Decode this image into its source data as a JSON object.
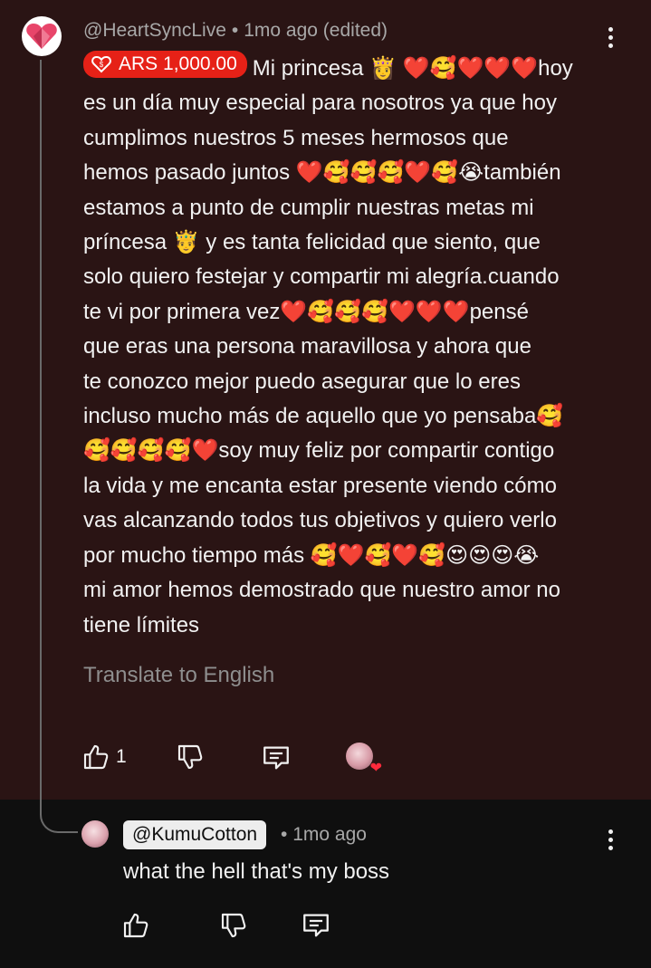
{
  "comment": {
    "author": "@HeartSyncLive",
    "separator": "•",
    "time": "1mo ago (edited)",
    "donation": "ARS 1,000.00",
    "lines": [
      "Mi princesa 👸 ❤️🥰❤️❤️❤️hoy",
      "es un día muy especial para nosotros ya que hoy",
      "cumplimos nuestros 5 meses hermosos que",
      "hemos pasado juntos ❤️🥰🥰🥰❤️🥰😭también",
      "estamos a punto de cumplir nuestras metas mi",
      "príncesa 🤴 y es tanta felicidad que siento, que",
      "solo quiero festejar y compartir mi alegría.cuando",
      "te vi por primera vez❤️🥰🥰🥰❤️❤️❤️pensé",
      "que eras una persona maravillosa y ahora que",
      "te conozco mejor puedo asegurar que lo eres",
      "incluso mucho más de aquello que yo pensaba🥰",
      "🥰🥰🥰🥰❤️soy muy feliz por compartir contigo",
      "la vida y me encanta estar presente viendo cómo",
      "vas alcanzando todos tus objetivos y quiero verlo",
      "por mucho tiempo más 🥰❤️🥰❤️🥰😍😍😍😭",
      "mi amor hemos demostrado que nuestro amor no",
      "tiene límites"
    ],
    "translate_label": "Translate to English",
    "like_count": "1",
    "icons": {
      "like": "thumbs-up-icon",
      "dislike": "thumbs-down-icon",
      "reply": "comment-icon",
      "menu": "more-vert-icon",
      "creator_heart": "creator-heart-icon"
    }
  },
  "reply": {
    "author": "@KumuCotton",
    "separator": "•",
    "time": "1mo ago",
    "text": "what the hell that's my boss"
  },
  "colors": {
    "background": "#0f0f0f",
    "highlight_background": "#2a1414",
    "donation_chip": "#e62117",
    "text": "#f1f1f1",
    "secondary_text": "#a8a8a8"
  }
}
